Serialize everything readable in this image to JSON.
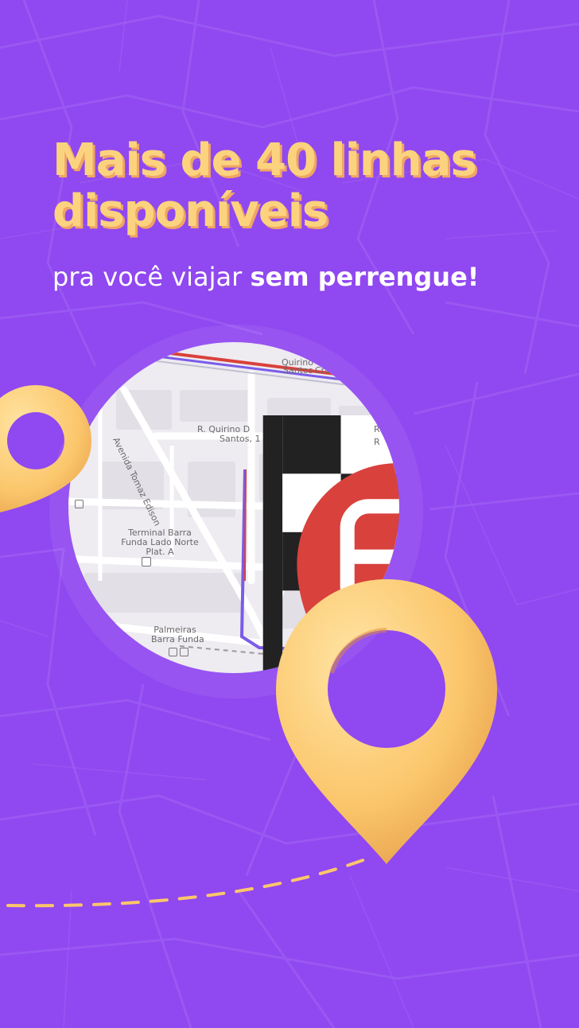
{
  "headline": {
    "line1": "Mais de 40 linhas",
    "line2": "disponíveis"
  },
  "subline": {
    "regular": "pra você viajar ",
    "bold": "sem perrengue!"
  },
  "map": {
    "labels": {
      "avenida": "Avenida Tomaz Edison",
      "quirino_top": "Quirino",
      "santos_top": "Santos",
      "cru": "Cru",
      "quirino": "R. Quirino D",
      "santos": "Santos, 1",
      "terminal_line1": "Terminal Barra",
      "terminal_line2": "Funda Lado Norte",
      "terminal_line3": "Plat. A",
      "palmeiras_line1": "Palmeiras",
      "palmeiras_line2": "Barra Funda",
      "r1": "R",
      "r2": "R"
    },
    "icons": {
      "destination": "checkered-flag-icon",
      "bus_stop": "bus-pin-icon",
      "station": "metro-icon"
    }
  },
  "colors": {
    "background": "#9048f0",
    "headline": "#fbd37e",
    "headline_shadow": "#f0a565",
    "pin": "#fbc66b",
    "route": "#7a5ce8",
    "route_red": "#d9413c",
    "dashes": "#fbc66b"
  }
}
